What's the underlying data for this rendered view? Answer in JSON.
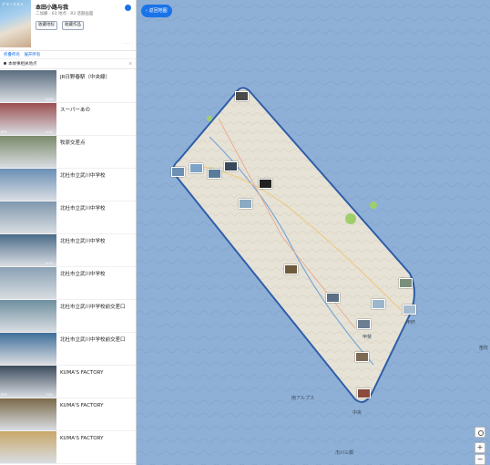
{
  "sidebar": {
    "title": "本田小路与我",
    "meta": "二加藤 · 63 地点 · 83 话题画面",
    "tags": [
      "收藏地标",
      "收藏作品"
    ],
    "links": [
      "折叠所有",
      "展开所有"
    ],
    "section": "本故事相关地点",
    "items": [
      {
        "name": "JR日野春駅（中央線）",
        "ep": "",
        "time": "0:05"
      },
      {
        "name": "スーパーあの",
        "ep": "EP3",
        "time": "0:35"
      },
      {
        "name": "牧原交差点",
        "ep": "",
        "time": ""
      },
      {
        "name": "北杜市立武川中学校",
        "ep": "",
        "time": ""
      },
      {
        "name": "北杜市立武川中学校",
        "ep": "",
        "time": ""
      },
      {
        "name": "北杜市立武川中学校",
        "ep": "",
        "time": "4:11"
      },
      {
        "name": "北杜市立武川中学校",
        "ep": "",
        "time": ""
      },
      {
        "name": "北杜市立武川中学校前交差口",
        "ep": "",
        "time": ""
      },
      {
        "name": "北杜市立武川中学校前交差口",
        "ep": "",
        "time": ""
      },
      {
        "name": "KUMA'S FACTORY",
        "ep": "EP3",
        "time": "7:01"
      },
      {
        "name": "KUMA'S FACTORY",
        "ep": "",
        "time": ""
      },
      {
        "name": "KUMA'S FACTORY",
        "ep": "",
        "time": ""
      }
    ]
  },
  "map": {
    "back_label": "返回地图",
    "labels": [
      {
        "text": "甲府"
      },
      {
        "text": "南アルプス"
      },
      {
        "text": "中央"
      },
      {
        "text": "市川三郷"
      },
      {
        "text": "笛吹"
      },
      {
        "text": "甲斐"
      }
    ],
    "zoom_in": "+",
    "zoom_out": "−"
  },
  "icons": {
    "back": "chevron-left-icon",
    "locate": "locate-icon"
  }
}
